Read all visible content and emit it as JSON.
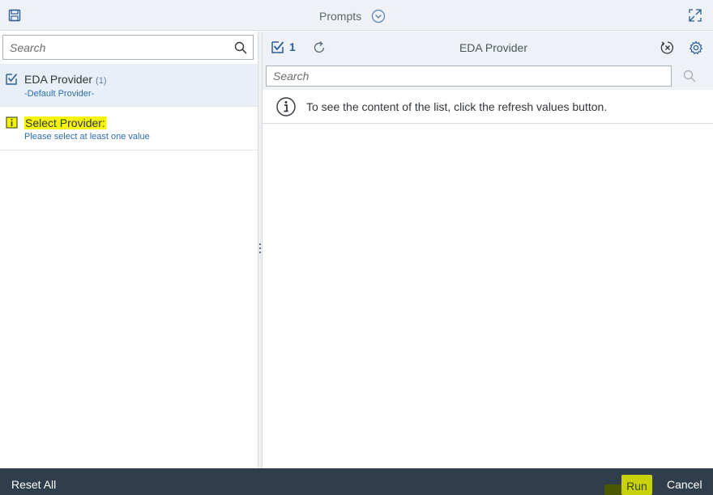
{
  "titlebar": {
    "title": "Prompts",
    "icons": {
      "save": "save-icon",
      "collapse": "chevron-down-circle-icon",
      "expand": "expand-icon"
    }
  },
  "left_pane": {
    "search": {
      "placeholder": "Search",
      "value": ""
    },
    "prompts": [
      {
        "name": "EDA Provider",
        "count": "(1)",
        "subtitle": "-Default Provider-",
        "status_icon": "checkbox-checked-icon",
        "selected": true
      },
      {
        "name": "Select Provider:",
        "subtitle": "Please select at least one value",
        "status_icon": "info-square-icon",
        "selected": false,
        "highlighted": true
      }
    ]
  },
  "right_pane": {
    "selected_count": "1",
    "title": "EDA Provider",
    "search": {
      "placeholder": "Search",
      "value": ""
    },
    "info_message": "To see the content of the list, click the refresh values button.",
    "icons": {
      "selected": "checkbox-checked-icon",
      "refresh": "refresh-icon",
      "clear": "clear-filter-icon",
      "settings": "gear-icon",
      "search": "search-icon",
      "info": "info-circle-icon"
    }
  },
  "footer": {
    "reset_label": "Reset All",
    "run_label": "Run",
    "cancel_label": "Cancel"
  },
  "colors": {
    "header_bg": "#eef2f6",
    "footer_bg": "#2f3d4c",
    "link_blue": "#2d6db0",
    "highlight": "#f5f50a",
    "run_highlight": "#c9d10a"
  }
}
